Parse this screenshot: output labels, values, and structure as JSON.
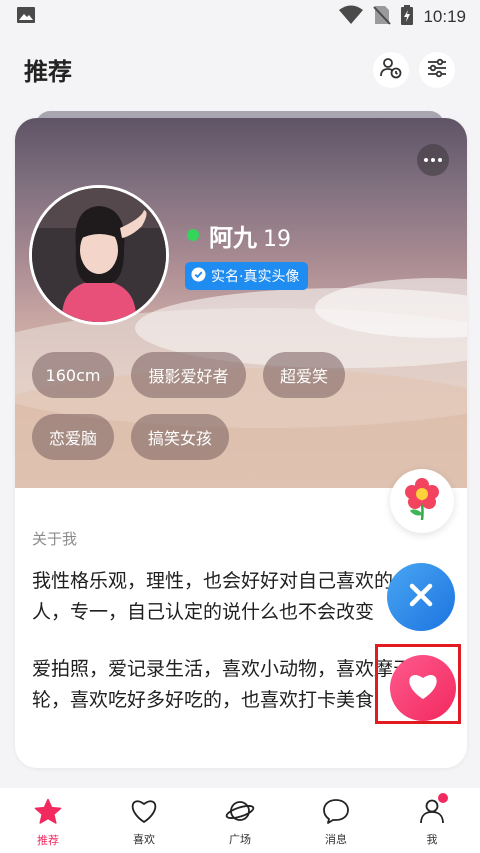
{
  "status": {
    "time": "10:19"
  },
  "header": {
    "title": "推荐",
    "visitors_icon": "user-clock-icon",
    "filter_icon": "sliders-icon"
  },
  "profile": {
    "name": "阿九",
    "age": "19",
    "online": true,
    "verified_label": "实名·真实头像",
    "tags": [
      "160cm",
      "摄影爱好者",
      "超爱笑",
      "恋爱脑",
      "搞笑女孩"
    ]
  },
  "about": {
    "title": "关于我",
    "para1_line1": "我性格乐观，理性，也会好好对自己喜欢的",
    "para1_line2": "人，专一，自己认定的说什么也不会改变",
    "para2_line1": "爱拍照，爱记录生活，喜欢小动物，喜欢摩天",
    "para2_line2": "轮，喜欢吃好多好吃的，也喜欢打卡美食"
  },
  "actions": {
    "flower_icon": "flower-icon",
    "pass_icon": "close-icon",
    "like_icon": "heart-icon"
  },
  "nav": [
    {
      "label": "推荐",
      "icon": "star-icon",
      "active": true
    },
    {
      "label": "喜欢",
      "icon": "heart-outline-icon",
      "active": false
    },
    {
      "label": "广场",
      "icon": "planet-icon",
      "active": false
    },
    {
      "label": "消息",
      "icon": "chat-bubble-icon",
      "active": false
    },
    {
      "label": "我",
      "icon": "person-icon",
      "active": false,
      "badge": true
    }
  ],
  "colors": {
    "accent": "#f2295f",
    "verify": "#1e8cf0",
    "online": "#34d35a",
    "pass": "#1c74e0"
  }
}
